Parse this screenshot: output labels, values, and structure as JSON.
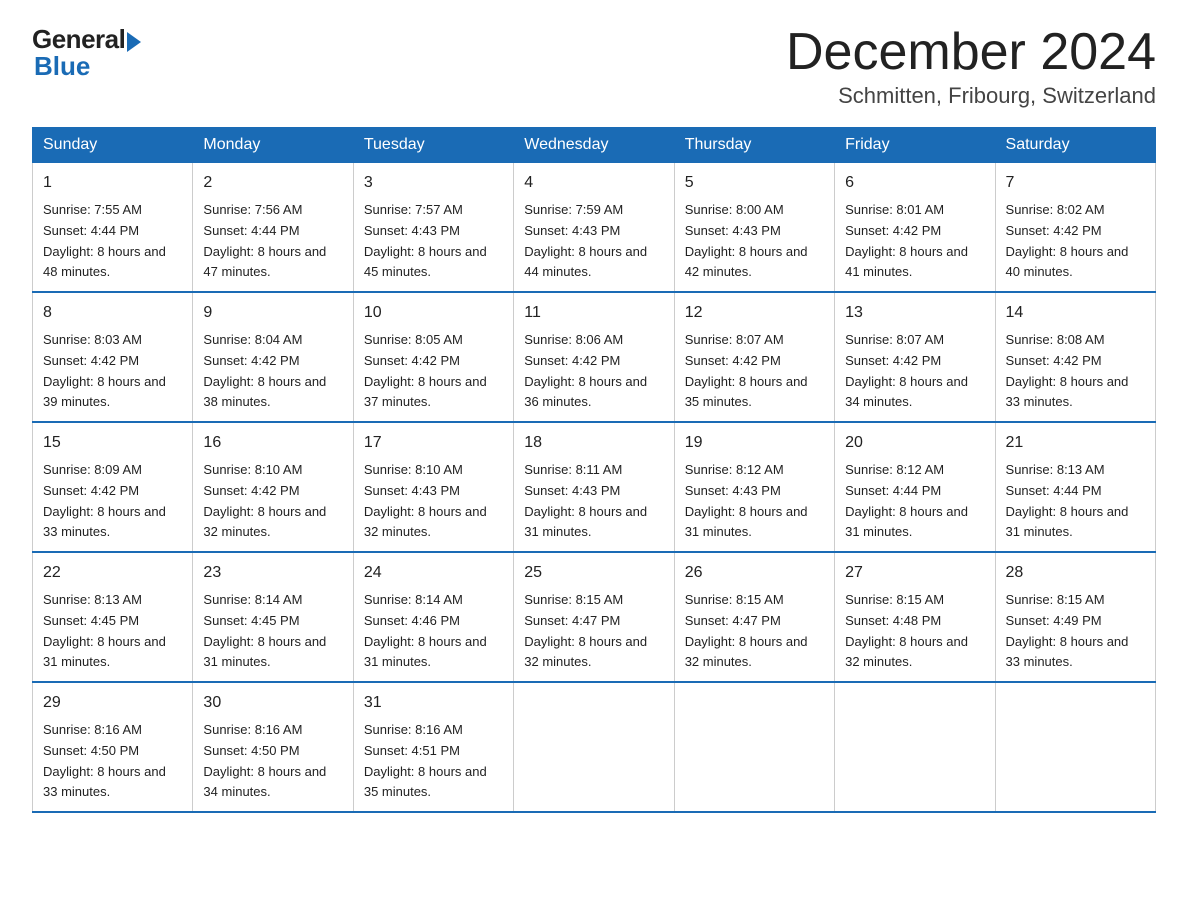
{
  "logo": {
    "general": "General",
    "blue": "Blue"
  },
  "title": "December 2024",
  "location": "Schmitten, Fribourg, Switzerland",
  "headers": [
    "Sunday",
    "Monday",
    "Tuesday",
    "Wednesday",
    "Thursday",
    "Friday",
    "Saturday"
  ],
  "weeks": [
    [
      {
        "day": "1",
        "sunrise": "7:55 AM",
        "sunset": "4:44 PM",
        "daylight": "8 hours and 48 minutes."
      },
      {
        "day": "2",
        "sunrise": "7:56 AM",
        "sunset": "4:44 PM",
        "daylight": "8 hours and 47 minutes."
      },
      {
        "day": "3",
        "sunrise": "7:57 AM",
        "sunset": "4:43 PM",
        "daylight": "8 hours and 45 minutes."
      },
      {
        "day": "4",
        "sunrise": "7:59 AM",
        "sunset": "4:43 PM",
        "daylight": "8 hours and 44 minutes."
      },
      {
        "day": "5",
        "sunrise": "8:00 AM",
        "sunset": "4:43 PM",
        "daylight": "8 hours and 42 minutes."
      },
      {
        "day": "6",
        "sunrise": "8:01 AM",
        "sunset": "4:42 PM",
        "daylight": "8 hours and 41 minutes."
      },
      {
        "day": "7",
        "sunrise": "8:02 AM",
        "sunset": "4:42 PM",
        "daylight": "8 hours and 40 minutes."
      }
    ],
    [
      {
        "day": "8",
        "sunrise": "8:03 AM",
        "sunset": "4:42 PM",
        "daylight": "8 hours and 39 minutes."
      },
      {
        "day": "9",
        "sunrise": "8:04 AM",
        "sunset": "4:42 PM",
        "daylight": "8 hours and 38 minutes."
      },
      {
        "day": "10",
        "sunrise": "8:05 AM",
        "sunset": "4:42 PM",
        "daylight": "8 hours and 37 minutes."
      },
      {
        "day": "11",
        "sunrise": "8:06 AM",
        "sunset": "4:42 PM",
        "daylight": "8 hours and 36 minutes."
      },
      {
        "day": "12",
        "sunrise": "8:07 AM",
        "sunset": "4:42 PM",
        "daylight": "8 hours and 35 minutes."
      },
      {
        "day": "13",
        "sunrise": "8:07 AM",
        "sunset": "4:42 PM",
        "daylight": "8 hours and 34 minutes."
      },
      {
        "day": "14",
        "sunrise": "8:08 AM",
        "sunset": "4:42 PM",
        "daylight": "8 hours and 33 minutes."
      }
    ],
    [
      {
        "day": "15",
        "sunrise": "8:09 AM",
        "sunset": "4:42 PM",
        "daylight": "8 hours and 33 minutes."
      },
      {
        "day": "16",
        "sunrise": "8:10 AM",
        "sunset": "4:42 PM",
        "daylight": "8 hours and 32 minutes."
      },
      {
        "day": "17",
        "sunrise": "8:10 AM",
        "sunset": "4:43 PM",
        "daylight": "8 hours and 32 minutes."
      },
      {
        "day": "18",
        "sunrise": "8:11 AM",
        "sunset": "4:43 PM",
        "daylight": "8 hours and 31 minutes."
      },
      {
        "day": "19",
        "sunrise": "8:12 AM",
        "sunset": "4:43 PM",
        "daylight": "8 hours and 31 minutes."
      },
      {
        "day": "20",
        "sunrise": "8:12 AM",
        "sunset": "4:44 PM",
        "daylight": "8 hours and 31 minutes."
      },
      {
        "day": "21",
        "sunrise": "8:13 AM",
        "sunset": "4:44 PM",
        "daylight": "8 hours and 31 minutes."
      }
    ],
    [
      {
        "day": "22",
        "sunrise": "8:13 AM",
        "sunset": "4:45 PM",
        "daylight": "8 hours and 31 minutes."
      },
      {
        "day": "23",
        "sunrise": "8:14 AM",
        "sunset": "4:45 PM",
        "daylight": "8 hours and 31 minutes."
      },
      {
        "day": "24",
        "sunrise": "8:14 AM",
        "sunset": "4:46 PM",
        "daylight": "8 hours and 31 minutes."
      },
      {
        "day": "25",
        "sunrise": "8:15 AM",
        "sunset": "4:47 PM",
        "daylight": "8 hours and 32 minutes."
      },
      {
        "day": "26",
        "sunrise": "8:15 AM",
        "sunset": "4:47 PM",
        "daylight": "8 hours and 32 minutes."
      },
      {
        "day": "27",
        "sunrise": "8:15 AM",
        "sunset": "4:48 PM",
        "daylight": "8 hours and 32 minutes."
      },
      {
        "day": "28",
        "sunrise": "8:15 AM",
        "sunset": "4:49 PM",
        "daylight": "8 hours and 33 minutes."
      }
    ],
    [
      {
        "day": "29",
        "sunrise": "8:16 AM",
        "sunset": "4:50 PM",
        "daylight": "8 hours and 33 minutes."
      },
      {
        "day": "30",
        "sunrise": "8:16 AM",
        "sunset": "4:50 PM",
        "daylight": "8 hours and 34 minutes."
      },
      {
        "day": "31",
        "sunrise": "8:16 AM",
        "sunset": "4:51 PM",
        "daylight": "8 hours and 35 minutes."
      },
      null,
      null,
      null,
      null
    ]
  ]
}
